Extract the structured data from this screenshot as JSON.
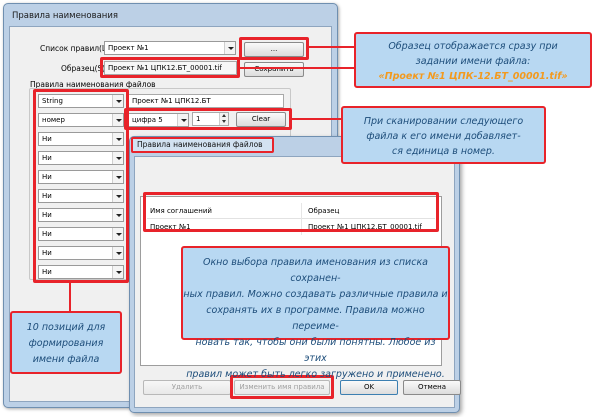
{
  "main_window": {
    "title": "Правила наименования",
    "rule_list_label": "Список правил(L)",
    "rule_list_value": "Проект №1",
    "browse_button": "...",
    "sample_label": "Образец(S)",
    "sample_value": "Проект №1 ЦПК12.БТ_00001.tif",
    "save_button": "Сохранить",
    "group_title": "Правила наименования файлов",
    "rows": [
      {
        "type": "String",
        "text": "Проект №1 ЦПК12.БТ"
      },
      {
        "type": "номер",
        "digits": "цифра 5",
        "start": "1",
        "clear": "Clear"
      },
      {
        "type": "Ни"
      },
      {
        "type": "Ни"
      },
      {
        "type": "Ни"
      },
      {
        "type": "Ни"
      },
      {
        "type": "Ни"
      },
      {
        "type": "Ни"
      },
      {
        "type": "Ни"
      },
      {
        "type": "Ни"
      }
    ]
  },
  "dialog": {
    "title": "Правила наименования файлов",
    "col_name": "Имя соглашений",
    "col_sample": "Образец",
    "row_name": "Проект №1",
    "row_sample": "Проект №1 ЦПК12.БТ_00001.tif",
    "btn_delete": "Удалить",
    "btn_rename": "Изменить имя правила",
    "btn_ok": "OK",
    "btn_cancel": "Отмена"
  },
  "callouts": {
    "sample_line1": "Образец отображается сразу при",
    "sample_line2": "задании имени файла:",
    "sample_highlight": "«Проект №1 ЦПК-12.БТ_00001.tif»",
    "scan_line1": "При сканировании следующего",
    "scan_line2": "файла к его имени добавляет-",
    "scan_line3": "ся единица в номер.",
    "dialog_line1": "Окно выбора правила именования из списка сохранен-",
    "dialog_line2": "ных правил. Можно создавать различные правила и",
    "dialog_line3": "сохранять их в программе. Правила можно переиме-",
    "dialog_line4": "новать так, чтобы они были понятны. Любое из этих",
    "dialog_line5": "правил может быть легко  загружено и применено.",
    "positions_line1": "10 позиций для",
    "positions_line2": "формирования",
    "positions_line3": "имени файла"
  },
  "colors": {
    "highlight": "#e8232a",
    "callout_bg": "#b8d8f2",
    "callout_text": "#1d4d7a",
    "accent_orange": "#f39a1e"
  }
}
